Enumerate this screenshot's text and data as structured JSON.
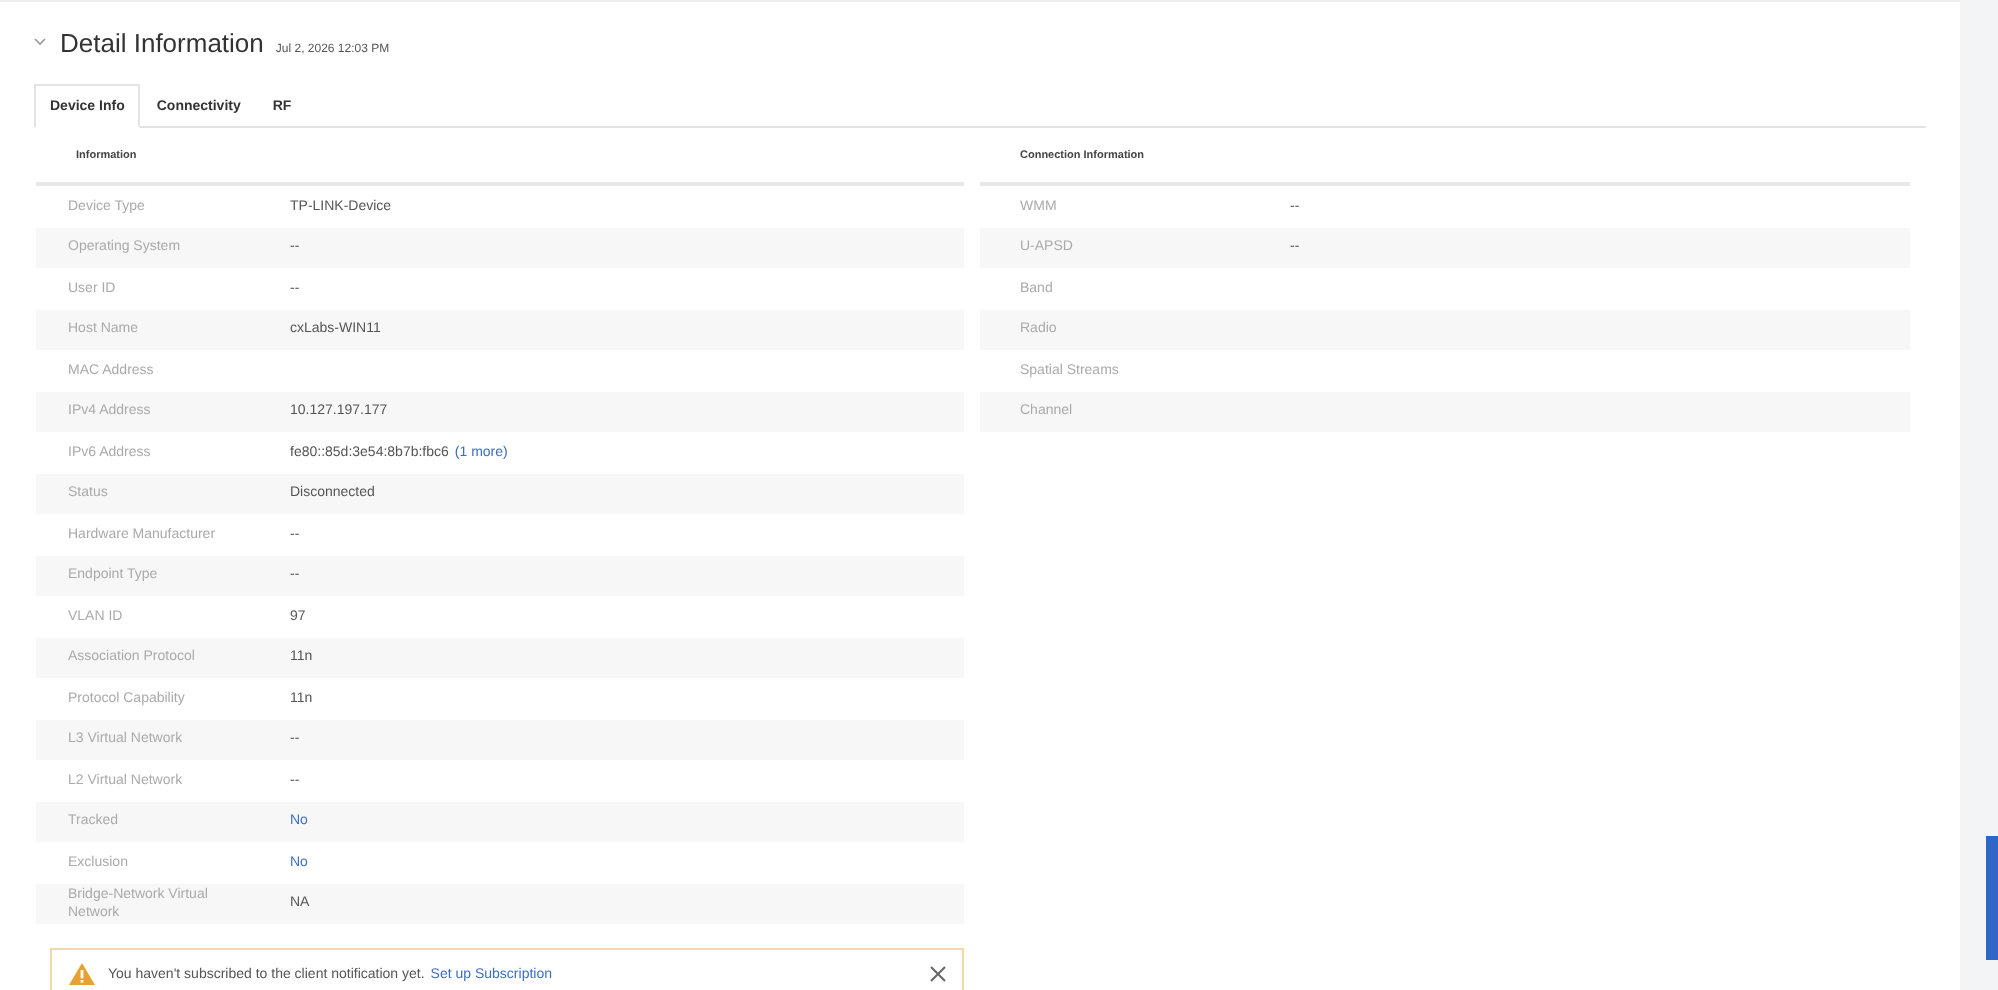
{
  "header": {
    "title": "Detail Information",
    "timestamp": "Jul 2, 2026 12:03 PM",
    "expanded": true
  },
  "tabs": [
    {
      "label": "Device Info",
      "selected": true
    },
    {
      "label": "Connectivity",
      "selected": false
    },
    {
      "label": "RF",
      "selected": false
    }
  ],
  "information": {
    "heading": "Information",
    "rows": [
      {
        "label": "Device Type",
        "value": "TP-LINK-Device",
        "kind": "text"
      },
      {
        "label": "Operating System",
        "value": "--",
        "kind": "text"
      },
      {
        "label": "User ID",
        "value": "--",
        "kind": "text"
      },
      {
        "label": "Host Name",
        "value": "cxLabs-WIN11",
        "kind": "text"
      },
      {
        "label": "MAC Address"
      },
      {
        "label": "IPv4 Address",
        "value": "10.127.197.177",
        "kind": "text"
      },
      {
        "label": "IPv6 Address",
        "value": "fe80::85d:3e54:8b7b:fbc6",
        "more": "(1 more)",
        "kind": "text"
      },
      {
        "label": "Status",
        "value": "Disconnected",
        "kind": "text"
      },
      {
        "label": "Hardware Manufacturer",
        "value": "--",
        "kind": "text"
      },
      {
        "label": "Endpoint Type",
        "value": "--",
        "kind": "text"
      },
      {
        "label": "VLAN ID",
        "value": "97",
        "kind": "text"
      },
      {
        "label": "Association Protocol",
        "value": "11n",
        "kind": "text"
      },
      {
        "label": "Protocol Capability",
        "value": "11n",
        "kind": "text"
      },
      {
        "label": "L3 Virtual Network",
        "value": "--",
        "kind": "text"
      },
      {
        "label": "L2 Virtual Network",
        "value": "--",
        "kind": "text"
      },
      {
        "label": "Tracked",
        "value": "No",
        "kind": "link"
      },
      {
        "label": "Exclusion",
        "value": "No",
        "kind": "link"
      },
      {
        "label": "Bridge-Network Virtual Network",
        "value": "NA",
        "kind": "text"
      }
    ]
  },
  "connection": {
    "heading": "Connection Information",
    "rows": [
      {
        "label": "WMM",
        "value": "--"
      },
      {
        "label": "U-APSD",
        "value": "--"
      },
      {
        "label": "Band"
      },
      {
        "label": "Radio"
      },
      {
        "label": "Spatial Streams"
      },
      {
        "label": "Channel"
      }
    ]
  },
  "notice": {
    "message": "You haven't subscribed to the client notification yet.",
    "link": "Set up Subscription"
  }
}
